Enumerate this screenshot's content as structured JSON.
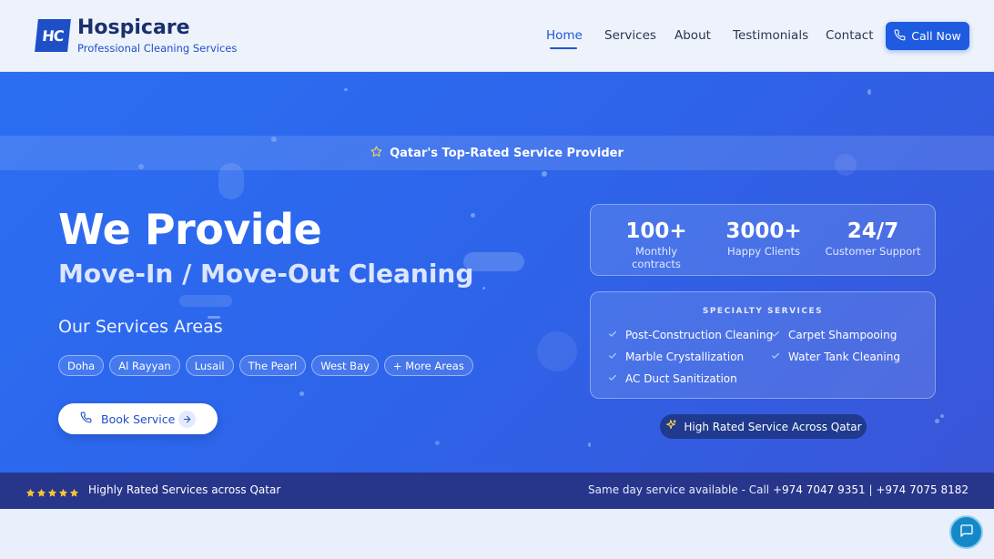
{
  "header": {
    "logo_text": "HC",
    "brand": "Hospicare",
    "tagline": "Professional Cleaning Services",
    "nav": [
      "Home",
      "Services",
      "About",
      "Testimonials",
      "Contact"
    ],
    "active_nav": "Home",
    "call_label": "Call Now"
  },
  "hero": {
    "banner": "Qatar's Top-Rated Service Provider",
    "title": "We Provide",
    "subtitle": "Move-In / Move-Out Cleaning",
    "areas_title": "Our Services Areas",
    "areas": [
      "Doha",
      "Al Rayyan",
      "Lusail",
      "The Pearl",
      "West Bay",
      "+ More Areas"
    ],
    "book_label": "Book Service",
    "stats": [
      {
        "num": "100+",
        "label": "Monthly contracts"
      },
      {
        "num": "3000+",
        "label": "Happy Clients"
      },
      {
        "num": "24/7",
        "label": "Customer Support"
      }
    ],
    "specialty_title": "SPECIALTY SERVICES",
    "specialty": [
      "Post-Construction Cleaning",
      "Carpet Shampooing",
      "Marble Crystallization",
      "Water Tank Cleaning",
      "AC Duct Sanitization"
    ],
    "rated_pill": "High Rated Service Across Qatar"
  },
  "strip": {
    "rating_stars": 5,
    "left": "Highly Rated Services across Qatar",
    "right_prefix": "Same day service available - Call",
    "phone1": "+974 7047 9351",
    "separator": "|",
    "phone2": "+974 7075 8182"
  },
  "colors": {
    "primary": "#1e5be0",
    "brand_dark": "#1a2f6e",
    "strip": "#27368a",
    "star": "#f7c531",
    "chat": "#1589c8"
  }
}
